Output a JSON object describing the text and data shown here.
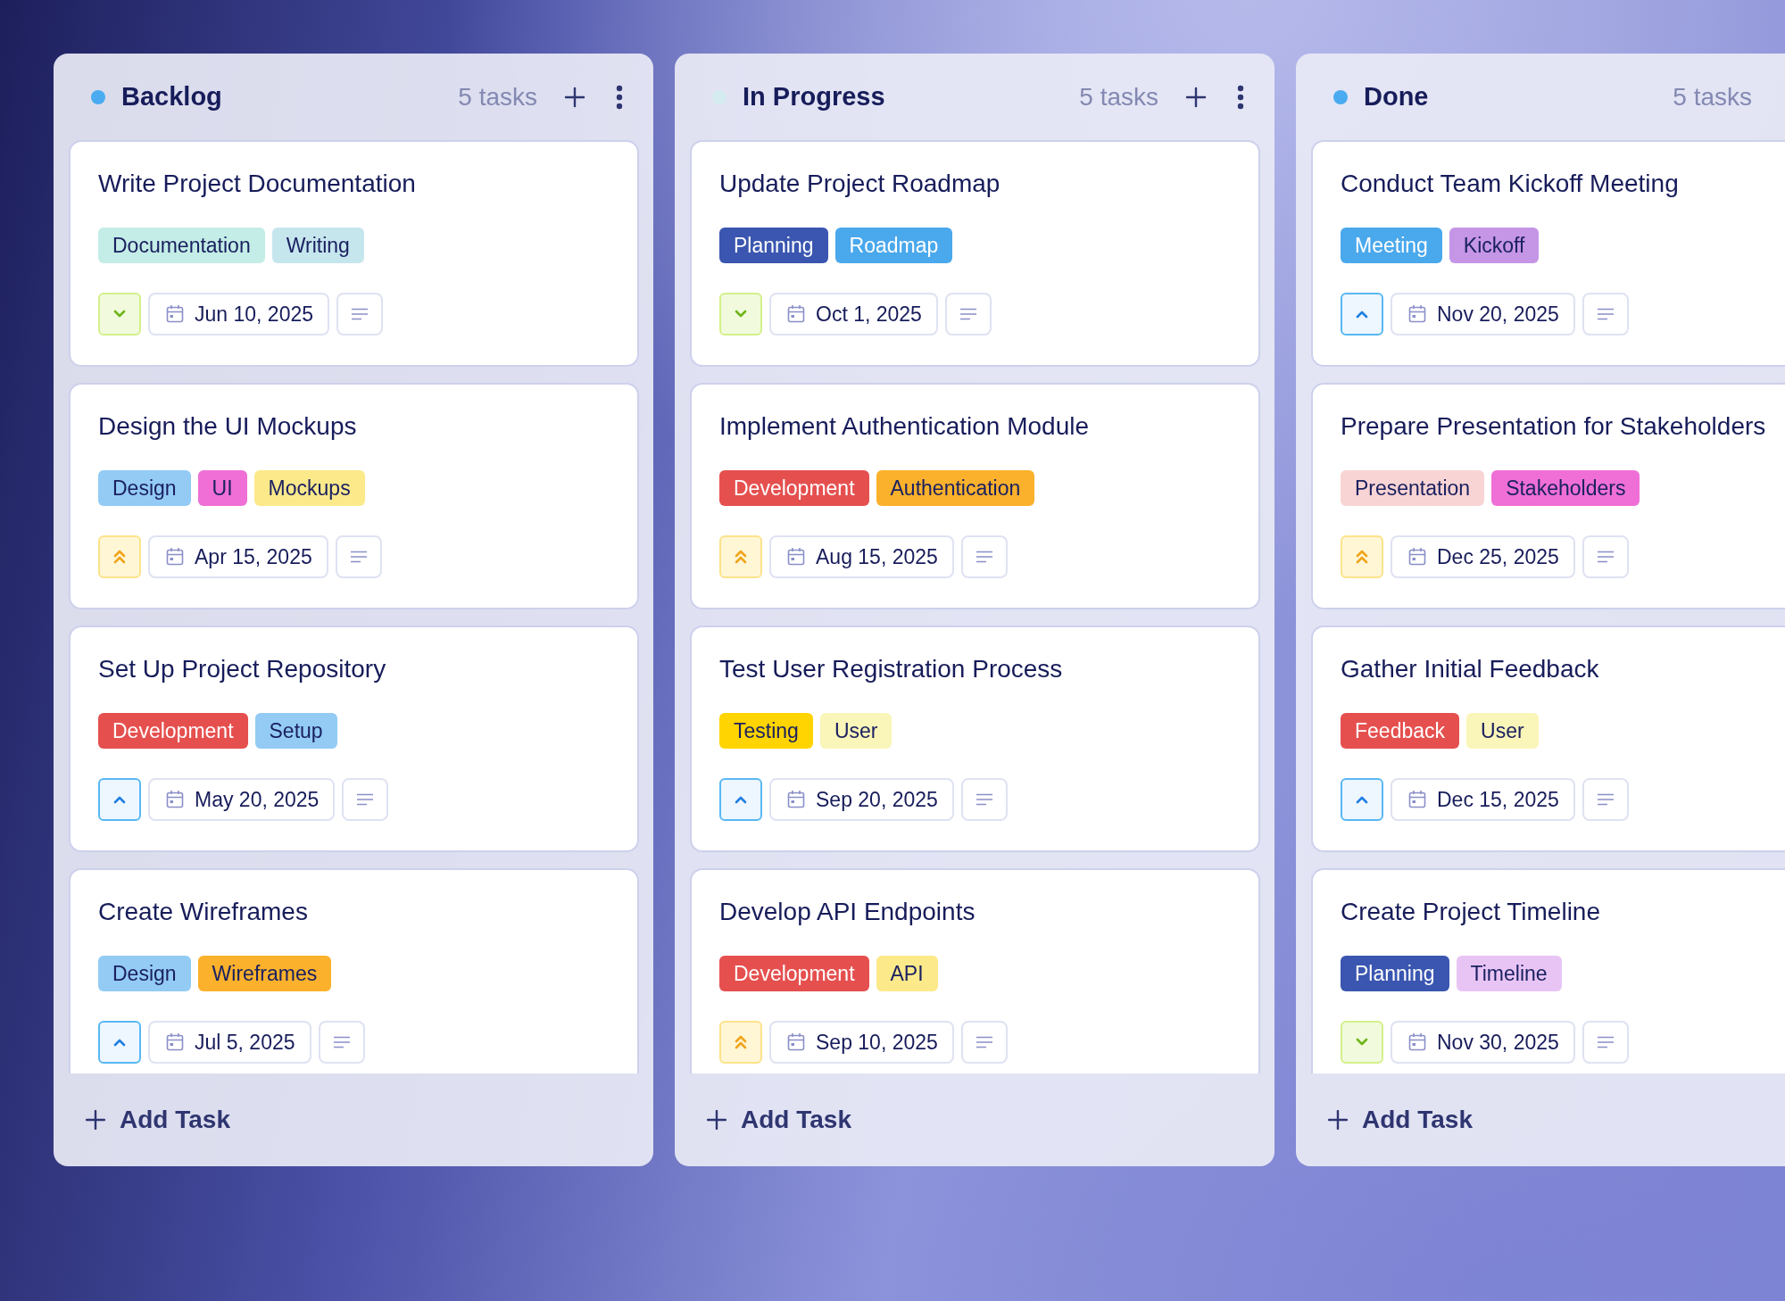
{
  "columns": [
    {
      "title": "Backlog",
      "color": "#4aabf0",
      "count": "5 tasks",
      "header_buttons": true,
      "add_label": "Add Task",
      "cards": [
        {
          "title": "Write Project Documentation",
          "tags": [
            {
              "label": "Documentation",
              "color": "#c3ede6"
            },
            {
              "label": "Writing",
              "color": "#c6e6ee"
            }
          ],
          "kind": "low",
          "date": "Jun 10, 2025"
        },
        {
          "title": "Design the UI Mockups",
          "tags": [
            {
              "label": "Design",
              "color": "#93cbf5"
            },
            {
              "label": "UI",
              "color": "#ef6fd6"
            },
            {
              "label": "Mockups",
              "color": "#fce98a"
            }
          ],
          "kind": "high",
          "date": "Apr 15, 2025"
        },
        {
          "title": "Set Up Project Repository",
          "tags": [
            {
              "label": "Development",
              "color": "#e5504f"
            },
            {
              "label": "Setup",
              "color": "#93cbf5"
            }
          ],
          "kind": "medium",
          "date": "May 20, 2025"
        },
        {
          "title": "Create Wireframes",
          "tags": [
            {
              "label": "Design",
              "color": "#93cbf5"
            },
            {
              "label": "Wireframes",
              "color": "#fbb12b"
            }
          ],
          "kind": "medium",
          "date": "Jul 5, 2025"
        }
      ]
    },
    {
      "title": "In Progress",
      "color": "#d4ecef",
      "count": "5 tasks",
      "header_buttons": true,
      "add_label": "Add Task",
      "cards": [
        {
          "title": "Update Project Roadmap",
          "tags": [
            {
              "label": "Planning",
              "color": "#3a56b0"
            },
            {
              "label": "Roadmap",
              "color": "#4aa8ec"
            }
          ],
          "kind": "low",
          "date": "Oct 1, 2025"
        },
        {
          "title": "Implement Authentication Module",
          "tags": [
            {
              "label": "Development",
              "color": "#e5504f"
            },
            {
              "label": "Authentication",
              "color": "#fbb12b"
            }
          ],
          "kind": "high",
          "date": "Aug 15, 2025"
        },
        {
          "title": "Test User Registration Process",
          "tags": [
            {
              "label": "Testing",
              "color": "#ffd400"
            },
            {
              "label": "User",
              "color": "#faf5b8"
            }
          ],
          "kind": "medium",
          "date": "Sep 20, 2025"
        },
        {
          "title": "Develop API Endpoints",
          "tags": [
            {
              "label": "Development",
              "color": "#e5504f"
            },
            {
              "label": "API",
              "color": "#fce98a"
            }
          ],
          "kind": "high",
          "date": "Sep 10, 2025"
        }
      ]
    },
    {
      "title": "Done",
      "color": "#4aabf0",
      "count": "5 tasks",
      "header_buttons": false,
      "add_label": "Add Task",
      "cards": [
        {
          "title": "Conduct Team Kickoff Meeting",
          "tags": [
            {
              "label": "Meeting",
              "color": "#4aa8ec"
            },
            {
              "label": "Kickoff",
              "color": "#c595e6"
            }
          ],
          "kind": "medium",
          "date": "Nov 20, 2025"
        },
        {
          "title": "Prepare Presentation for Stakeholders",
          "tags": [
            {
              "label": "Presentation",
              "color": "#f9d4d4"
            },
            {
              "label": "Stakeholders",
              "color": "#ef6fd6"
            }
          ],
          "kind": "high",
          "date": "Dec 25, 2025"
        },
        {
          "title": "Gather Initial Feedback",
          "tags": [
            {
              "label": "Feedback",
              "color": "#e5504f"
            },
            {
              "label": "User",
              "color": "#faf5b8"
            }
          ],
          "kind": "medium",
          "date": "Dec 15, 2025"
        },
        {
          "title": "Create Project Timeline",
          "tags": [
            {
              "label": "Planning",
              "color": "#3a56b0"
            },
            {
              "label": "Timeline",
              "color": "#e8c4f5"
            }
          ],
          "kind": "low",
          "date": "Nov 30, 2025"
        }
      ]
    }
  ]
}
